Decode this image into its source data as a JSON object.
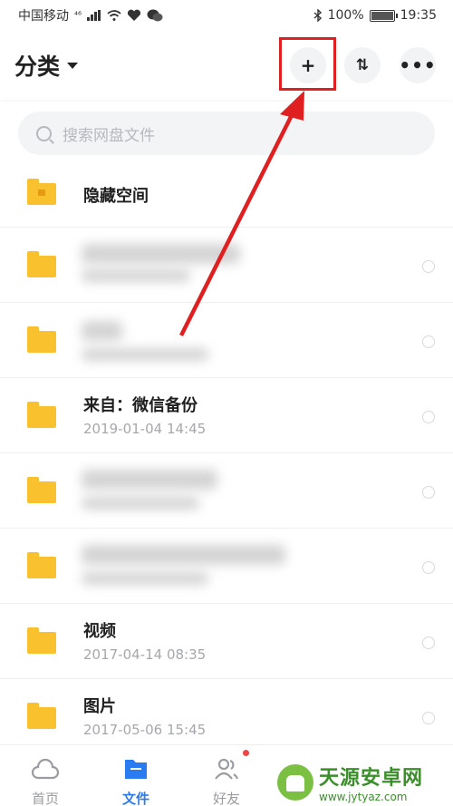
{
  "status_bar": {
    "carrier": "中国移动",
    "network": "⁴⁶",
    "battery": "100%",
    "time": "19:35"
  },
  "header": {
    "title": "分类",
    "add_label": "+",
    "sort_label": "⇅",
    "more_label": "•••"
  },
  "search": {
    "placeholder": "搜索网盘文件"
  },
  "files": [
    {
      "name": "隐藏空间",
      "date": "",
      "locked": true
    },
    {
      "name": "",
      "date": "",
      "blurred": true
    },
    {
      "name": "",
      "date": "",
      "blurred": true
    },
    {
      "name": "来自：微信备份",
      "date": "2019-01-04  14:45"
    },
    {
      "name": "",
      "date": "",
      "blurred": true
    },
    {
      "name": "",
      "date": "",
      "blurred": true
    },
    {
      "name": "视频",
      "date": "2017-04-14  08:35"
    },
    {
      "name": "图片",
      "date": "2017-05-06  15:45"
    }
  ],
  "tabbar": {
    "items": [
      {
        "label": "首页"
      },
      {
        "label": "文件"
      },
      {
        "label": "好友"
      }
    ]
  },
  "watermark": {
    "title": "天源安卓网",
    "url": "www.jytyaz.com"
  },
  "colors": {
    "folder": "#fac12f",
    "accent": "#2b7bf0",
    "annotation": "#e02020"
  }
}
